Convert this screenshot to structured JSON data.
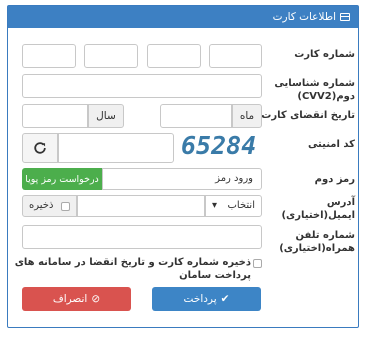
{
  "header": {
    "title": "اطلاعات کارت",
    "icon": "credit-card-icon"
  },
  "labels": {
    "card_number": "شماره کارت",
    "cvv2_line1": "شماره شناسایی",
    "cvv2_line2": "دوم(CVV2)",
    "expiry": "تاریخ انقضای کارت",
    "captcha": "کد امنیتی",
    "pin2": "رمز دوم",
    "email_line1": "آدرس",
    "email_line2": "ایمیل(اختیاری)",
    "mobile_line1": "شماره تلفن",
    "mobile_line2": "همراه(اختیاری)"
  },
  "expiry": {
    "month_label": "ماه",
    "year_label": "سال"
  },
  "captcha": {
    "code": "65284",
    "refresh_icon": "refresh-icon"
  },
  "pin2": {
    "placeholder": "ورود رمز",
    "request_button": "درخواست رمز پویا"
  },
  "email": {
    "select_value": "انتخاب",
    "save_label": "ذخیره"
  },
  "save_card": {
    "line1": "ذخیره شماره کارت و تاریخ انقضا در سامانه های",
    "line2": "پرداخت سامان"
  },
  "buttons": {
    "pay": "پرداخت",
    "cancel": "انصراف"
  },
  "colors": {
    "primary": "#3d80c3",
    "success": "#4cae4c",
    "danger": "#d9534f"
  }
}
